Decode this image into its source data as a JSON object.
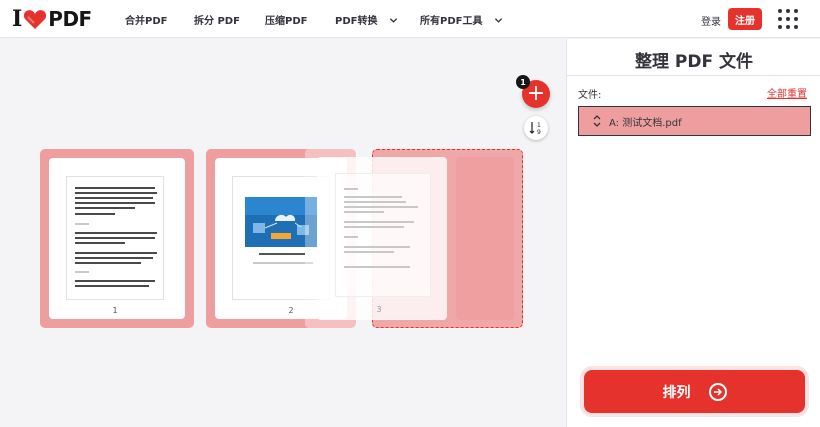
{
  "brand": {
    "logo_i": "I",
    "logo_pdf": "PDF",
    "accent": "#e5322d"
  },
  "nav": [
    {
      "label": "合并PDF"
    },
    {
      "label": "拆分 PDF"
    },
    {
      "label": "压缩PDF"
    },
    {
      "label": "PDF转换"
    },
    {
      "label": "所有PDF工具"
    }
  ],
  "account": {
    "login": "登录",
    "signup": "注册"
  },
  "workspace": {
    "add_count": "1",
    "add_icon": "+",
    "pages": [
      {
        "number": "1"
      },
      {
        "number": "2",
        "caption": "图 1·1 HCIA 云计算 认证 考试 路线图"
      },
      {
        "number": "3"
      }
    ]
  },
  "panel": {
    "title": "整理 PDF 文件",
    "files_label": "文件:",
    "reset_label": "全部重置",
    "file_name": "A: 测试文档.pdf",
    "submit_label": "排列"
  }
}
